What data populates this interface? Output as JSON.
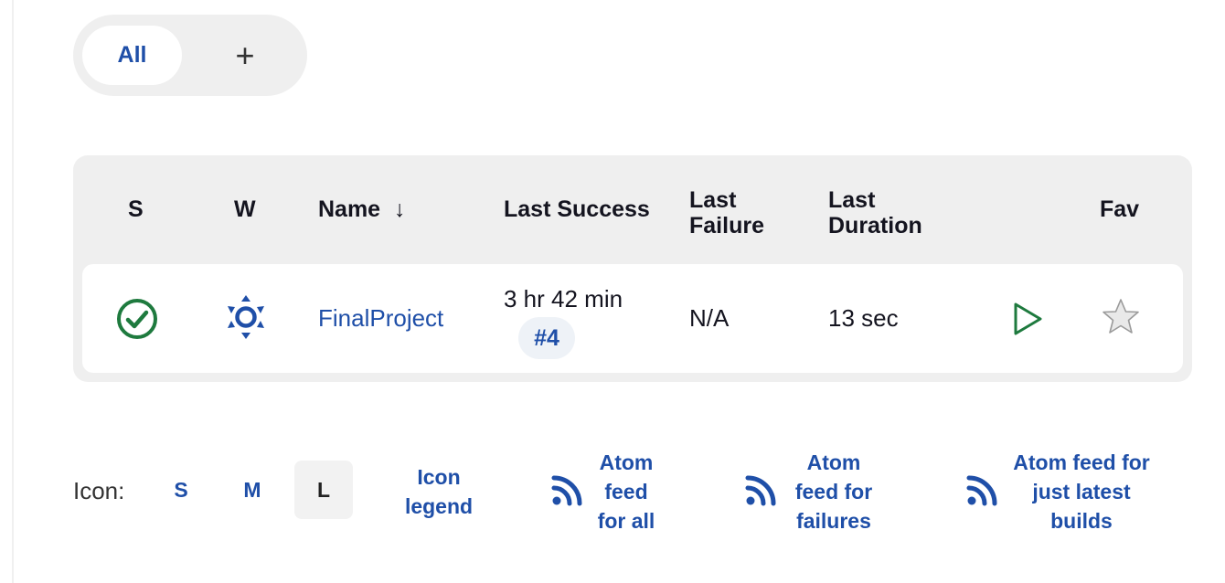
{
  "tabs": {
    "all_label": "All",
    "add_label": "+"
  },
  "table": {
    "headers": {
      "status": "S",
      "weather": "W",
      "name": "Name",
      "sort_arrow": "↓",
      "last_success": "Last Success",
      "last_failure_1": "Last",
      "last_failure_2": "Failure",
      "last_duration_1": "Last",
      "last_duration_2": "Duration",
      "fav": "Fav"
    },
    "rows": [
      {
        "status_icon": "success-check-icon",
        "weather_icon": "sunny-weather-icon",
        "name": "FinalProject",
        "last_success": "3 hr 42 min",
        "last_success_build": "#4",
        "last_failure": "N/A",
        "last_duration": "13 sec",
        "run_icon": "play-icon",
        "fav_icon": "star-icon"
      }
    ]
  },
  "footer": {
    "icon_label": "Icon:",
    "sizes": [
      "S",
      "M",
      "L"
    ],
    "active_size": "L",
    "legend_1": "Icon",
    "legend_2": "legend",
    "feed_all_1": "Atom",
    "feed_all_2": "feed",
    "feed_all_3": "for all",
    "feed_failures_1": "Atom",
    "feed_failures_2": "feed for",
    "feed_failures_3": "failures",
    "feed_latest_1": "Atom feed for",
    "feed_latest_2": "just latest",
    "feed_latest_3": "builds"
  },
  "colors": {
    "link": "#1f4fa8",
    "success": "#1e7a3e",
    "panel_bg": "#efefef"
  }
}
